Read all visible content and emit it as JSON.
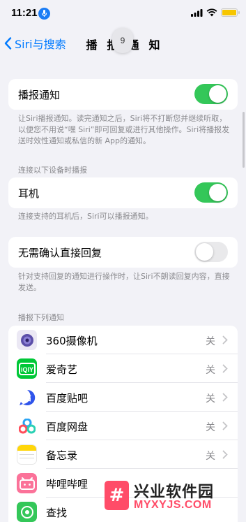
{
  "status_bar": {
    "time": "11:21"
  },
  "nav": {
    "back_label": "Siri与搜索",
    "title": "播报通知",
    "floating_badge": "9"
  },
  "announce": {
    "label": "播报通知",
    "toggle_on": true,
    "footnote": "让Siri播报通知。读完通知之后，Siri将不打断您并继续听取，以便您不用说“嘿 Siri”即可回复或进行其他操作。Siri将播报发送时效性通知或私信的新 App的通知。"
  },
  "devices": {
    "header": "连接以下设备时播报",
    "headphones_label": "耳机",
    "headphones_on": true,
    "footnote": "连接支持的耳机后，Siri可以播报通知。"
  },
  "reply": {
    "label": "无需确认直接回复",
    "toggle_on": false,
    "footnote": "针对支持回复的通知进行操作时，让Siri不朗读回复内容，直接发送。"
  },
  "apps": {
    "header": "播报下列通知",
    "items": [
      {
        "name": "360摄像机",
        "value": "关",
        "icon": "360-camera-icon",
        "color": "#e9e6f3"
      },
      {
        "name": "爱奇艺",
        "value": "关",
        "icon": "iqiyi-icon",
        "color": "#00c837"
      },
      {
        "name": "百度贴吧",
        "value": "关",
        "icon": "baidu-tieba-icon",
        "color": "#2f54eb"
      },
      {
        "name": "百度网盘",
        "value": "关",
        "icon": "baidu-netdisk-icon",
        "color": "#ffffff"
      },
      {
        "name": "备忘录",
        "value": "关",
        "icon": "notes-icon",
        "color": "#ffd60a"
      },
      {
        "name": "哔哩哔哩",
        "value": "",
        "icon": "bilibili-icon",
        "color": "#fb7299"
      },
      {
        "name": "查找",
        "value": "",
        "icon": "find-my-icon",
        "color": "#34c759"
      }
    ]
  },
  "watermark": {
    "title": "兴业软件园",
    "domain": "MYXYJS.COM"
  }
}
